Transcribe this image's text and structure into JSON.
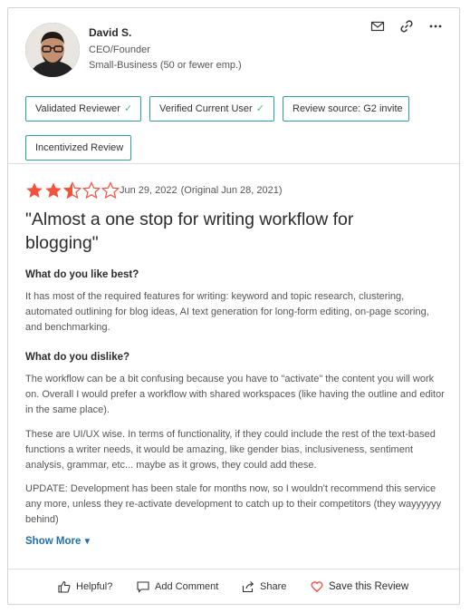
{
  "reviewer": {
    "name": "David S.",
    "role": "CEO/Founder",
    "segment": "Small-Business (50 or fewer emp.)"
  },
  "header_icons": [
    "mail-icon",
    "link-icon",
    "more-icon"
  ],
  "badges": [
    {
      "label": "Validated Reviewer",
      "check": true
    },
    {
      "label": "Verified Current User",
      "check": true
    },
    {
      "label": "Review source: G2 invite",
      "check": false
    },
    {
      "label": "Incentivized Review",
      "check": false
    }
  ],
  "rating": {
    "value": 2.5,
    "max": 5,
    "color": "#f4513c"
  },
  "date": {
    "posted": "Jun 29, 2022",
    "original": "(Original Jun 28, 2021)"
  },
  "title": "\"Almost a one stop for writing workflow for blogging\"",
  "sections": {
    "like_q": "What do you like best?",
    "like_a": "It has most of the required features for writing: keyword and topic research, clustering, automated outlining for blog ideas, AI text generation for long-form editing, on-page scoring, and benchmarking.",
    "dislike_q": "What do you dislike?",
    "dislike_a1": "The workflow can be a bit confusing because you have to \"activate\" the content you will work on. Overall I would prefer a workflow with shared workspaces (like having the outline and editor in the same place).",
    "dislike_a2": "These are UI/UX wise. In terms of functionality, if they could include the rest of the text-based functions a writer needs, it would be amazing, like gender bias, inclusiveness, sentiment analysis, grammar, etc... maybe as it grows, they could add these.",
    "dislike_a3": "UPDATE: Development has been stale for months now, so I wouldn't recommend this service any more, unless they re-activate development to catch up to their competitors (they wayyyyyy behind)"
  },
  "show_more": "Show More",
  "footer": {
    "helpful": "Helpful?",
    "comment": "Add Comment",
    "share": "Share",
    "save": "Save this Review"
  },
  "colors": {
    "accent_border": "#2aa1a0",
    "check": "#3fbf8a",
    "link": "#1f6fb2",
    "star": "#f4513c"
  }
}
